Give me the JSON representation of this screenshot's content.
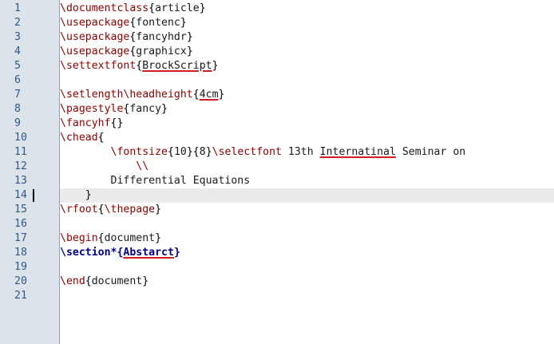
{
  "editor": {
    "line_numbers": [
      "1",
      "2",
      "3",
      "4",
      "5",
      "6",
      "7",
      "8",
      "9",
      "10",
      "11",
      "12",
      "13",
      "14",
      "15",
      "16",
      "17",
      "18",
      "19",
      "20",
      "21"
    ],
    "current_line": "14",
    "lines": [
      [
        {
          "t": "\\documentclass",
          "k": "cmd"
        },
        {
          "t": "{",
          "k": "brace"
        },
        {
          "t": "article",
          "k": "text"
        },
        {
          "t": "}",
          "k": "brace"
        }
      ],
      [
        {
          "t": "\\usepackage",
          "k": "cmd"
        },
        {
          "t": "{",
          "k": "brace"
        },
        {
          "t": "fontenc",
          "k": "text"
        },
        {
          "t": "}",
          "k": "brace"
        }
      ],
      [
        {
          "t": "\\usepackage",
          "k": "cmd"
        },
        {
          "t": "{",
          "k": "brace"
        },
        {
          "t": "fancyhdr",
          "k": "text"
        },
        {
          "t": "}",
          "k": "brace"
        }
      ],
      [
        {
          "t": "\\usepackage",
          "k": "cmd"
        },
        {
          "t": "{",
          "k": "brace"
        },
        {
          "t": "graphicx",
          "k": "text"
        },
        {
          "t": "}",
          "k": "brace"
        }
      ],
      [
        {
          "t": "\\settextfont",
          "k": "cmd"
        },
        {
          "t": "{",
          "k": "brace"
        },
        {
          "t": "BrockScript",
          "k": "text",
          "u": true
        },
        {
          "t": "}",
          "k": "brace"
        }
      ],
      [],
      [
        {
          "t": "\\setlength",
          "k": "cmd"
        },
        {
          "t": "\\headheight",
          "k": "cmd"
        },
        {
          "t": "{",
          "k": "brace"
        },
        {
          "t": "4cm",
          "k": "text",
          "u": true
        },
        {
          "t": "}",
          "k": "brace"
        }
      ],
      [
        {
          "t": "\\pagestyle",
          "k": "cmd"
        },
        {
          "t": "{",
          "k": "brace"
        },
        {
          "t": "fancy",
          "k": "text"
        },
        {
          "t": "}",
          "k": "brace"
        }
      ],
      [
        {
          "t": "\\fancyhf",
          "k": "cmd"
        },
        {
          "t": "{}",
          "k": "brace"
        }
      ],
      [
        {
          "t": "\\chead",
          "k": "cmd"
        },
        {
          "t": "{",
          "k": "brace"
        }
      ],
      [
        {
          "t": "        ",
          "k": "text"
        },
        {
          "t": "\\fontsize",
          "k": "cmd"
        },
        {
          "t": "{",
          "k": "brace"
        },
        {
          "t": "10",
          "k": "text"
        },
        {
          "t": "}{",
          "k": "brace"
        },
        {
          "t": "8",
          "k": "text"
        },
        {
          "t": "}",
          "k": "brace"
        },
        {
          "t": "\\selectfont",
          "k": "cmd"
        },
        {
          "t": " 13th ",
          "k": "text"
        },
        {
          "t": "Internatinal",
          "k": "text",
          "u": true
        },
        {
          "t": " Seminar on",
          "k": "text"
        }
      ],
      [
        {
          "t": "            ",
          "k": "text"
        },
        {
          "t": "\\\\",
          "k": "cmd"
        }
      ],
      [
        {
          "t": "        Differential Equations",
          "k": "text"
        }
      ],
      [
        {
          "t": "    ",
          "k": "text"
        },
        {
          "t": "}",
          "k": "brace"
        }
      ],
      [
        {
          "t": "\\rfoot",
          "k": "cmd"
        },
        {
          "t": "{",
          "k": "brace"
        },
        {
          "t": "\\thepage",
          "k": "cmd"
        },
        {
          "t": "}",
          "k": "brace"
        }
      ],
      [],
      [
        {
          "t": "\\begin",
          "k": "cmd"
        },
        {
          "t": "{",
          "k": "brace"
        },
        {
          "t": "document",
          "k": "text"
        },
        {
          "t": "}",
          "k": "brace"
        }
      ],
      [
        {
          "t": "\\section*",
          "k": "sec"
        },
        {
          "t": "{",
          "k": "sec"
        },
        {
          "t": "Abstarct",
          "k": "sec",
          "u": true
        },
        {
          "t": "}",
          "k": "sec"
        }
      ],
      [],
      [
        {
          "t": "\\end",
          "k": "cmd"
        },
        {
          "t": "{",
          "k": "brace"
        },
        {
          "t": "document",
          "k": "text"
        },
        {
          "t": "}",
          "k": "brace"
        }
      ],
      []
    ]
  },
  "colors": {
    "gutter_bg": "#dde3eb",
    "line_number": "#2c5a8a",
    "command": "#8b0000",
    "section": "#00008b",
    "spell_underline": "#d02020",
    "current_line_bg": "#ebebeb"
  }
}
